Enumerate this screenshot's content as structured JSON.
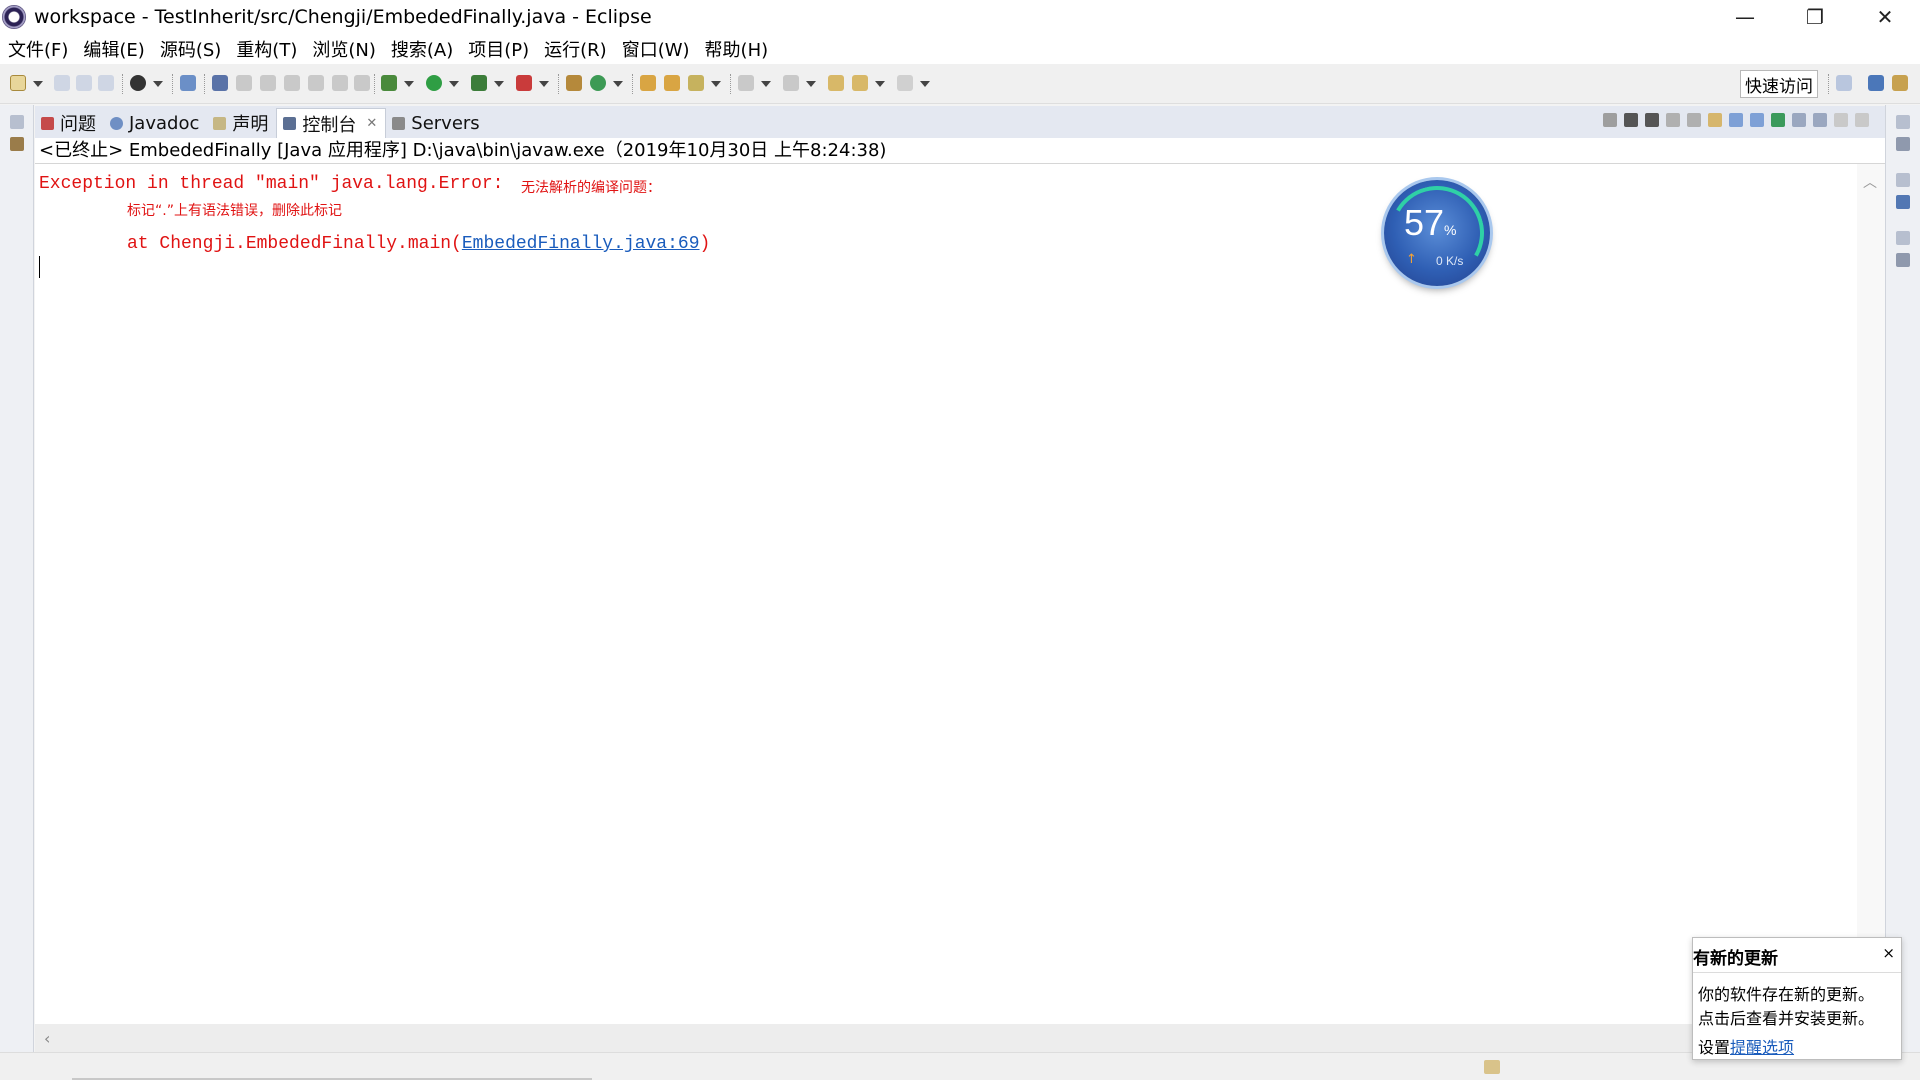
{
  "window": {
    "title": "workspace - TestInherit/src/Chengji/EmbededFinally.java - Eclipse",
    "controls": {
      "minimize": "—",
      "maximize": "❐",
      "close": "✕"
    }
  },
  "menu": [
    "文件(F)",
    "编辑(E)",
    "源码(S)",
    "重构(T)",
    "浏览(N)",
    "搜索(A)",
    "项目(P)",
    "运行(R)",
    "窗口(W)",
    "帮助(H)"
  ],
  "toolbar": {
    "quick_access": "快速访问"
  },
  "view": {
    "tabs": [
      {
        "label": "问题",
        "icon": "problems-icon"
      },
      {
        "label": "Javadoc",
        "icon": "javadoc-icon"
      },
      {
        "label": "声明",
        "icon": "declaration-icon"
      },
      {
        "label": "控制台",
        "icon": "console-icon",
        "active": true,
        "close": "✕"
      },
      {
        "label": "Servers",
        "icon": "servers-icon"
      }
    ]
  },
  "console": {
    "launch_description": "<已终止> EmbededFinally [Java 应用程序] D:\\java\\bin\\javaw.exe（2019年10月30日 上午8:24:38)",
    "exception_line": "Exception in thread \"main\" java.lang.Error: ",
    "exception_cjk": "无法解析的编译问题：",
    "syntax_message": "标记“.”上有语法错误，删除此标记",
    "stack_prefix": "at Chengji.EmbededFinally.main(",
    "stack_link": "EmbededFinally.java:69",
    "stack_suffix": ")"
  },
  "gauge": {
    "percent": "57",
    "percent_sign": "%",
    "speed": "0 K/s",
    "up_icon": "↑"
  },
  "update_popup": {
    "title": "有新的更新",
    "close": "×",
    "message_line1": "你的软件存在新的更新。",
    "message_line2": "点击后查看并安装更新。",
    "settings_prefix": "设置",
    "settings_link": "提醒选项"
  },
  "colors": {
    "error_red": "#e01313",
    "link_blue": "#1a5cbc",
    "tab_bar": "#e4e8f1"
  }
}
